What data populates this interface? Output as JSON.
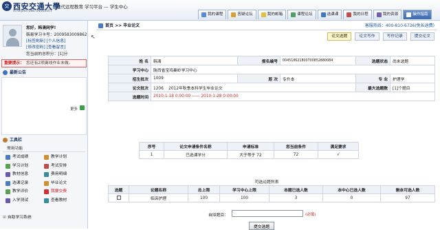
{
  "header": {
    "logo_cn": "西安交通大學",
    "logo_en": "XI'AN JIAOTONG UNIVERSITY",
    "platform_title": "现代远程教育 学习平台 — 学生中心",
    "nav": [
      "我的课程",
      "答疑论坛",
      "我的邮箱",
      "课程论坛",
      "选课课",
      "我的日程",
      "我的资源",
      "操作指南"
    ]
  },
  "sidebar": {
    "greeting": "您好，韩清网学!",
    "student_no": "韩易学习卡号：2009583009862",
    "links_1": [
      "[标签刷新]",
      "[个人信息]"
    ],
    "links_2": [
      "[修改密码]",
      "[查看留言]"
    ],
    "credits": "您当前的总积分：[1]分",
    "notice_label": "重要提示：",
    "notice_msg": "您还有2项离线作业未做。",
    "announce_title": "最新公告",
    "more": "更多",
    "tools_title": "工具栏",
    "tools_sub": "常用功能",
    "tools": [
      "考试成绩",
      "教学计划",
      "学习计划",
      "考试安排",
      "教材信息",
      "费用明细",
      "选课记录",
      "毕业论文",
      "教学评价",
      "我要交费",
      "入学测试",
      "查看教材"
    ],
    "self_study": "自助学习系统"
  },
  "main": {
    "breadcrumb": "首页 >> 毕业论文",
    "hotline": "客服热线：400-810-6736(免长途费)",
    "subtabs": [
      "论文选题",
      "论文写作",
      "写作记录",
      "提交论文"
    ],
    "info": {
      "name_label": "姓 名",
      "name": "韩清",
      "regno_label": "报名编号",
      "regno": "004518621800700852880084",
      "status_label": "选题状态",
      "status": "尚未选题",
      "center_label": "学习中心",
      "center": "陕西省宝鸡秦岭学习中心",
      "batch_label": "招生批次",
      "batch": "1009",
      "level_label": "层 次",
      "level": "专升本",
      "major_label": "专 业",
      "major": "护理学",
      "thesis_batch_label": "论文批次",
      "thesis_batch_code": "1206",
      "thesis_batch_name": "2012年秋季本科学生毕业论文",
      "max_label": "最大选题数",
      "max": "[1]个题目",
      "time_label": "选题时间",
      "time": "2010-1-18 0:00:00 —— 2010-1-28 0:00:00"
    },
    "requirements": {
      "headers": [
        "序号",
        "论文申请条件名称",
        "申请标准",
        "您当前条件",
        "满足要求"
      ],
      "rows": [
        [
          "1",
          "已选课学分",
          "大于等于 72",
          "72",
          "√"
        ]
      ]
    },
    "topic_caption": "可选论题列表",
    "topics": {
      "headers": [
        "选题",
        "论题名称",
        "总上限",
        "学习中心上限",
        "本题已选人数",
        "本中心已选人数",
        "剩余可选人数"
      ],
      "rows": [
        [
          "",
          "临床护理",
          "100",
          "100",
          "3",
          "0",
          "97"
        ]
      ]
    },
    "self_topic_label": "自拟题目：",
    "self_topic_value": "",
    "required": "(必填)",
    "submit": "提交选题"
  }
}
